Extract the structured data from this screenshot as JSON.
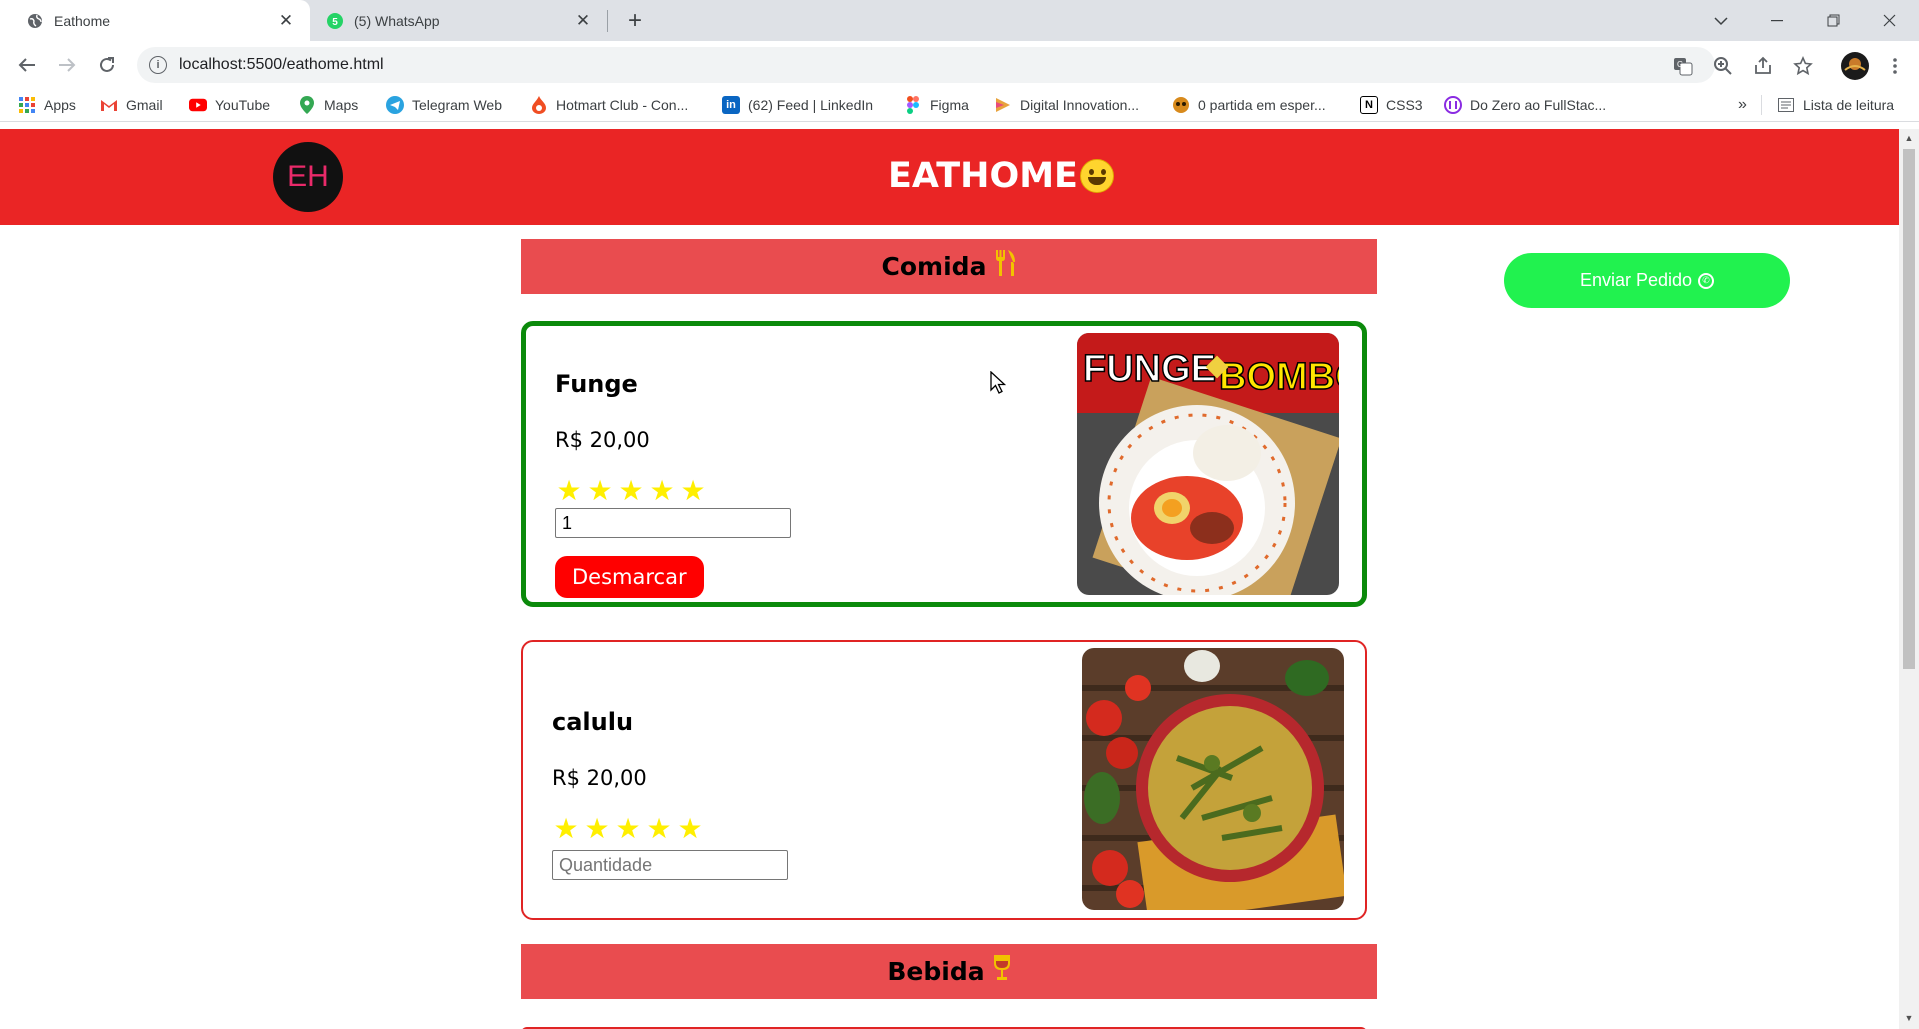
{
  "browser": {
    "tabs": [
      {
        "title": "Eathome",
        "active": true,
        "icon": "globe-icon"
      },
      {
        "title": "(5) WhatsApp",
        "active": false,
        "icon": "whatsapp-icon",
        "badge": "5"
      }
    ],
    "address": "localhost:5500/eathome.html",
    "bookmarks": [
      {
        "label": "Apps",
        "icon": "apps-grid-icon",
        "color": "#4285f4"
      },
      {
        "label": "Gmail",
        "icon": "gmail-icon",
        "color": "#ea4335"
      },
      {
        "label": "YouTube",
        "icon": "youtube-icon",
        "color": "#ff0000"
      },
      {
        "label": "Maps",
        "icon": "maps-pin-icon",
        "color": "#34a853"
      },
      {
        "label": "Telegram Web",
        "icon": "telegram-icon",
        "color": "#2aa3e0"
      },
      {
        "label": "Hotmart Club - Con...",
        "icon": "hotmart-flame-icon",
        "color": "#f04e23"
      },
      {
        "label": "(62) Feed | LinkedIn",
        "icon": "linkedin-icon",
        "color": "#0a66c2"
      },
      {
        "label": "Figma",
        "icon": "figma-icon",
        "color": "#a259ff"
      },
      {
        "label": "Digital Innovation...",
        "icon": "dio-icon",
        "color": "#e8a33d"
      },
      {
        "label": "0 partida em esper...",
        "icon": "game-icon",
        "color": "#d88a1c"
      },
      {
        "label": "CSS3",
        "icon": "notion-icon",
        "color": "#000000"
      },
      {
        "label": "Do Zero ao FullStac...",
        "icon": "course-icon",
        "color": "#8a2be2"
      }
    ],
    "reading_list": "Lista de leitura"
  },
  "site": {
    "logo_text": "EH",
    "title": "EATHOME",
    "send_button": "Enviar Pedido",
    "brand_color": "#ea2525",
    "sections": {
      "food": "Comida",
      "drink": "Bebida"
    },
    "items": [
      {
        "name": "Funge",
        "price": "R$ 20,00",
        "rating": 5,
        "quantity": "1",
        "selected": true,
        "unmark_label": "Desmarcar",
        "image_caption": "FUNGE DE BOMBÓ"
      },
      {
        "name": "calulu",
        "price": "R$ 20,00",
        "rating": 5,
        "quantity": "",
        "quantity_placeholder": "Quantidade",
        "selected": false
      }
    ]
  }
}
